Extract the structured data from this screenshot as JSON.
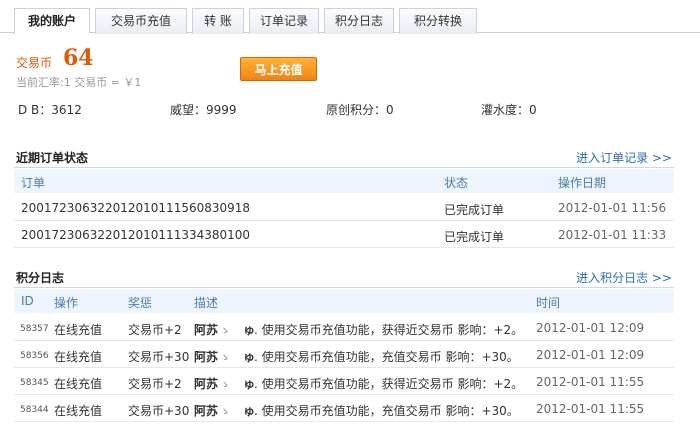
{
  "tabs": [
    {
      "label": "我的账户",
      "active": true
    },
    {
      "label": "交易币充值",
      "active": false
    },
    {
      "label": "转 账",
      "active": false
    },
    {
      "label": "订单记录",
      "active": false
    },
    {
      "label": "积分日志",
      "active": false
    },
    {
      "label": "积分转换",
      "active": false
    }
  ],
  "balance": {
    "label": "交易币",
    "value": "64",
    "rate": "当前汇率:1 交易币 = ￥1",
    "recharge_button": "马上充值"
  },
  "stats": {
    "db": "D B：3612",
    "prestige": "威望：9999",
    "original_points": "原创积分：0",
    "water_level": "灌水度：0"
  },
  "orders": {
    "title": "近期订单状态",
    "link": "进入订单记录 >>",
    "headers": {
      "order": "订单",
      "status": "状态",
      "date": "操作日期"
    },
    "rows": [
      {
        "order": "20017230632201201011156083091​8",
        "status": "已完成订单",
        "date": "2012-01-01 11:56"
      },
      {
        "order": "20017230632201201011133438010​0",
        "status": "已完成订单",
        "date": "2012-01-01 11:33"
      }
    ]
  },
  "points_log": {
    "title": "积分日志",
    "link": "进入积分日志 >>",
    "headers": {
      "id": "ID",
      "action": "操作",
      "reward": "奖惩",
      "desc": "描述",
      "time": "时间"
    },
    "rows": [
      {
        "id": "58357",
        "action": "在线充值",
        "reward": "交易币+2",
        "user": "阿苏",
        "user_suffix": "ゝ",
        "mark": "ゅ",
        "desc": ". 使用交易币充值功能，获得近交易币 影响：+2。",
        "time": "2012-01-01 12:09"
      },
      {
        "id": "58356",
        "action": "在线充值",
        "reward": "交易币+30",
        "user": "阿苏",
        "user_suffix": "ゝ",
        "mark": "ゅ",
        "desc": ". 使用交易币充值功能，充值交易币 影响：+30。",
        "time": "2012-01-01 12:09"
      },
      {
        "id": "58345",
        "action": "在线充值",
        "reward": "交易币+2",
        "user": "阿苏",
        "user_suffix": "ゝ",
        "mark": "ゅ",
        "desc": ". 使用交易币充值功能，获得近交易币 影响：+2。",
        "time": "2012-01-01 11:55"
      },
      {
        "id": "58344",
        "action": "在线充值",
        "reward": "交易币+30",
        "user": "阿苏",
        "user_suffix": "ゝ",
        "mark": "ゅ",
        "desc": ". 使用交易币充值功能，充值交易币 影响：+30。",
        "time": "2012-01-01 11:55"
      }
    ]
  }
}
